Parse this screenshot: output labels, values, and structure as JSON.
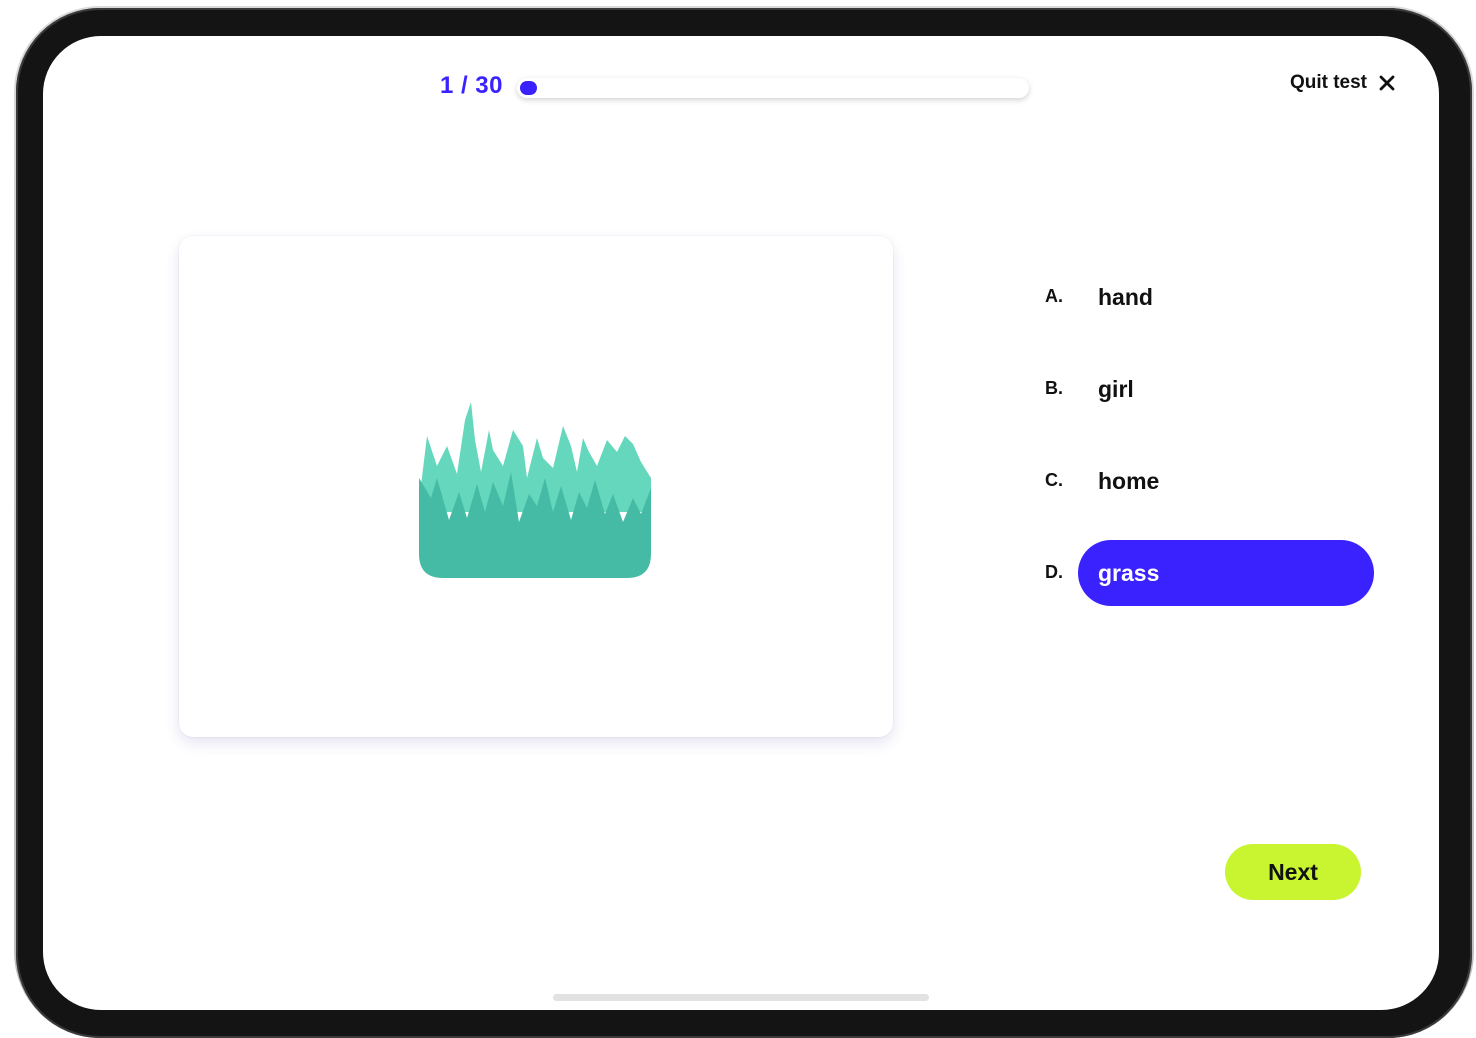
{
  "progress": {
    "label": "1 / 30",
    "current": 1,
    "total": 30,
    "fill_fraction": 0.033,
    "accent_color": "#3a22ff"
  },
  "quit": {
    "label": "Quit test",
    "icon": "close-icon"
  },
  "question": {
    "image": "grass-image",
    "image_colors": [
      "#64d7bd",
      "#45bba6"
    ]
  },
  "options": [
    {
      "letter": "A.",
      "word": "hand",
      "selected": false
    },
    {
      "letter": "B.",
      "word": "girl",
      "selected": false
    },
    {
      "letter": "C.",
      "word": "home",
      "selected": false
    },
    {
      "letter": "D.",
      "word": "grass",
      "selected": true
    }
  ],
  "next": {
    "label": "Next",
    "color": "#c8f530"
  }
}
